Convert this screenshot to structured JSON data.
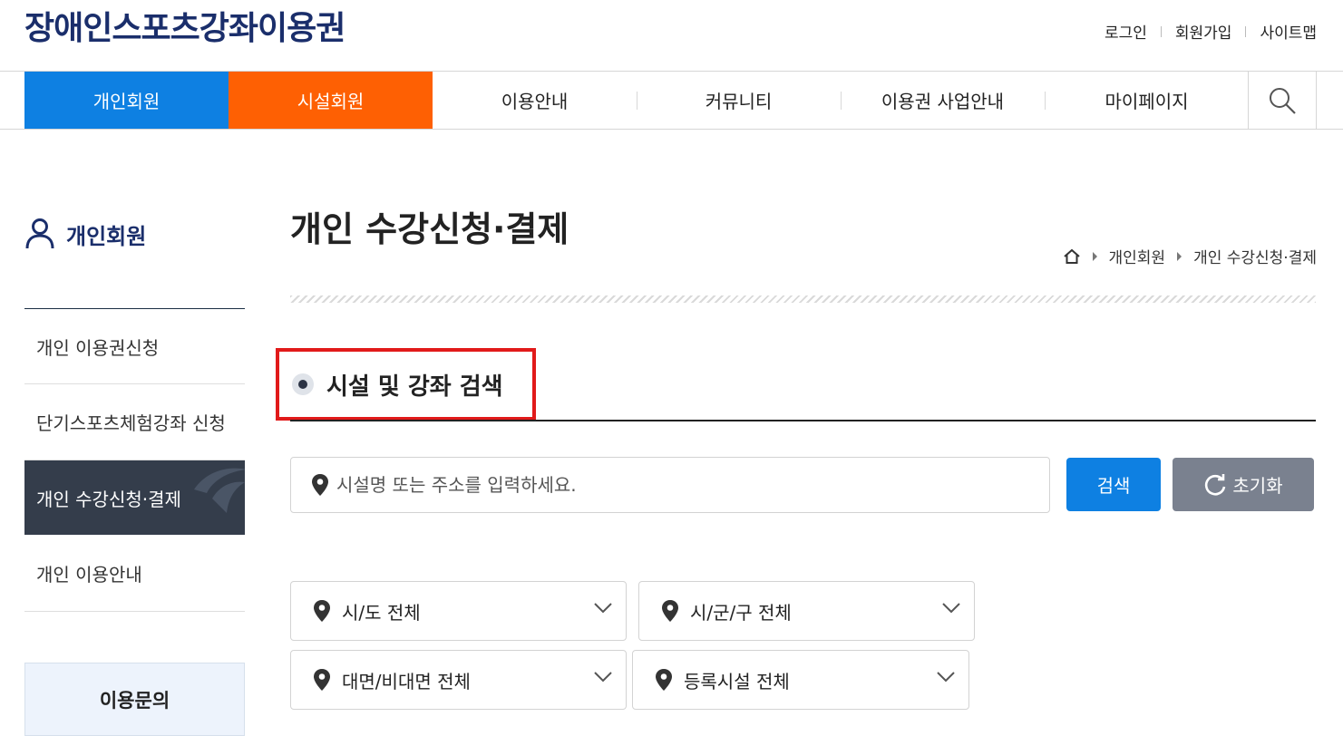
{
  "header": {
    "logo": "장애인스포츠강좌이용권",
    "util_links": [
      "로그인",
      "회원가입",
      "사이트맵"
    ]
  },
  "gnb": {
    "items": [
      "개인회원",
      "시설회원",
      "이용안내",
      "커뮤니티",
      "이용권 사업안내",
      "마이페이지"
    ],
    "search_icon": "search-icon"
  },
  "sidebar": {
    "title": "개인회원",
    "title_icon": "person-icon",
    "items": [
      "개인 이용권신청",
      "단기스포츠체험강좌 신청",
      "개인 수강신청·결제",
      "개인 이용안내"
    ],
    "active_index": 2,
    "contact": "이용문의"
  },
  "main": {
    "page_title": "개인 수강신청·결제",
    "breadcrumb": [
      "개인회원",
      "개인 수강신청·결제"
    ],
    "section_title": "시설 및 강좌 검색",
    "search": {
      "placeholder": "시설명 또는 주소를 입력하세요.",
      "search_button": "검색",
      "reset_button": "초기화"
    },
    "filters": [
      "시/도 전체",
      "시/군/구 전체",
      "대면/비대면 전체",
      "등록시설 전체"
    ]
  },
  "colors": {
    "personal": "#0e80e2",
    "facility": "#fe6003",
    "navy": "#1a2e6b",
    "sidebar_active": "#343d4b",
    "highlight_border": "#e11a1a",
    "reset_button": "#7a818f"
  }
}
